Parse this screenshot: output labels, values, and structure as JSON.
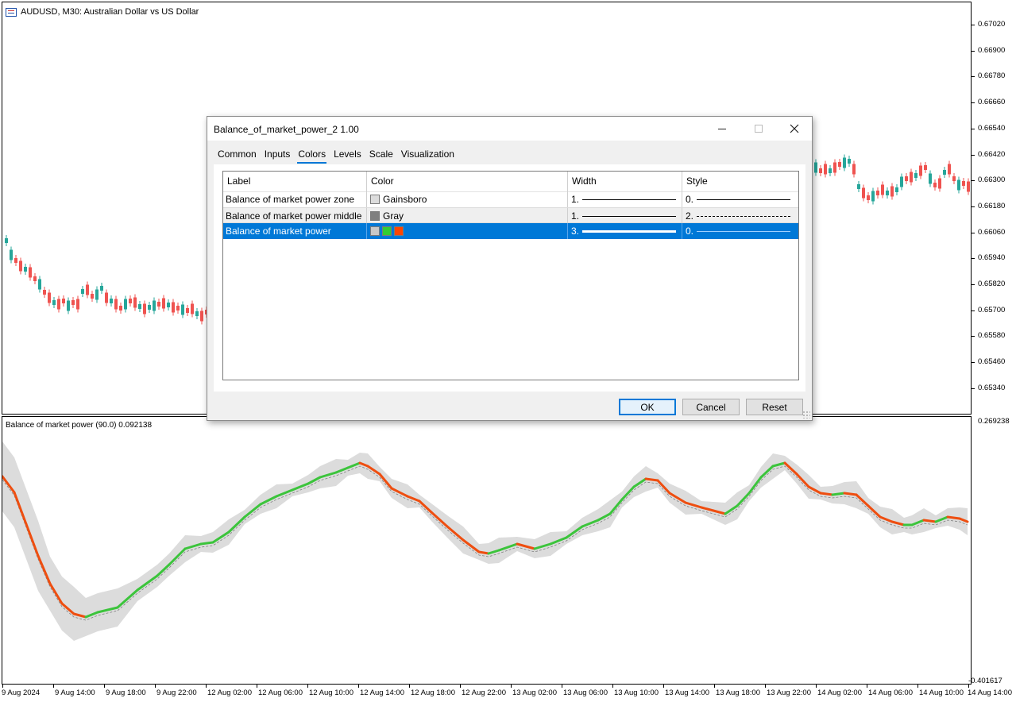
{
  "chart": {
    "symbol_title": "AUDUSD, M30:  Australian Dollar vs US Dollar",
    "indicator_title": "Balance of market power (90.0) 0.092138",
    "price_labels": [
      "0.67020",
      "0.66900",
      "0.66780",
      "0.66660",
      "0.66540",
      "0.66420",
      "0.66300",
      "0.66180",
      "0.66060",
      "0.65940",
      "0.65820",
      "0.65700",
      "0.65580",
      "0.65460",
      "0.65340"
    ],
    "indicator_max_label": "0.269238",
    "indicator_min_label": "-0.401617",
    "time_labels": [
      "9 Aug 2024",
      "9 Aug 14:00",
      "9 Aug 18:00",
      "9 Aug 22:00",
      "12 Aug 02:00",
      "12 Aug 06:00",
      "12 Aug 10:00",
      "12 Aug 14:00",
      "12 Aug 18:00",
      "12 Aug 22:00",
      "13 Aug 02:00",
      "13 Aug 06:00",
      "13 Aug 10:00",
      "13 Aug 14:00",
      "13 Aug 18:00",
      "13 Aug 22:00",
      "14 Aug 02:00",
      "14 Aug 06:00",
      "14 Aug 10:00",
      "14 Aug 14:00"
    ],
    "colors": {
      "bull": "#26a69a",
      "bear": "#ef5350",
      "up_line": "#3cc43c",
      "down_line": "#ee4e10",
      "zone": "#dcdcdc",
      "middle": "#808080"
    }
  },
  "dialog": {
    "title": "Balance_of_market_power_2 1.00",
    "minimize_icon": "minimize-icon",
    "maximize_icon": "maximize-icon",
    "close_icon": "close-icon",
    "tabs": [
      "Common",
      "Inputs",
      "Colors",
      "Levels",
      "Scale",
      "Visualization"
    ],
    "active_tab": "Colors",
    "columns": [
      "Label",
      "Color",
      "Width",
      "Style"
    ],
    "rows": [
      {
        "label": "Balance of market power zone",
        "color_name": "Gainsboro",
        "swatches": [
          "#dcdcdc"
        ],
        "width": "1.",
        "style": "0."
      },
      {
        "label": "Balance of market power middle",
        "color_name": "Gray",
        "swatches": [
          "#808080"
        ],
        "width": "1.",
        "style": "2."
      },
      {
        "label": "Balance of market power",
        "color_name": "",
        "swatches": [
          "#c8c8c8",
          "#32cd32",
          "#ff4500"
        ],
        "width": "3.",
        "style": "0."
      }
    ],
    "buttons": {
      "ok": "OK",
      "cancel": "Cancel",
      "reset": "Reset"
    }
  }
}
